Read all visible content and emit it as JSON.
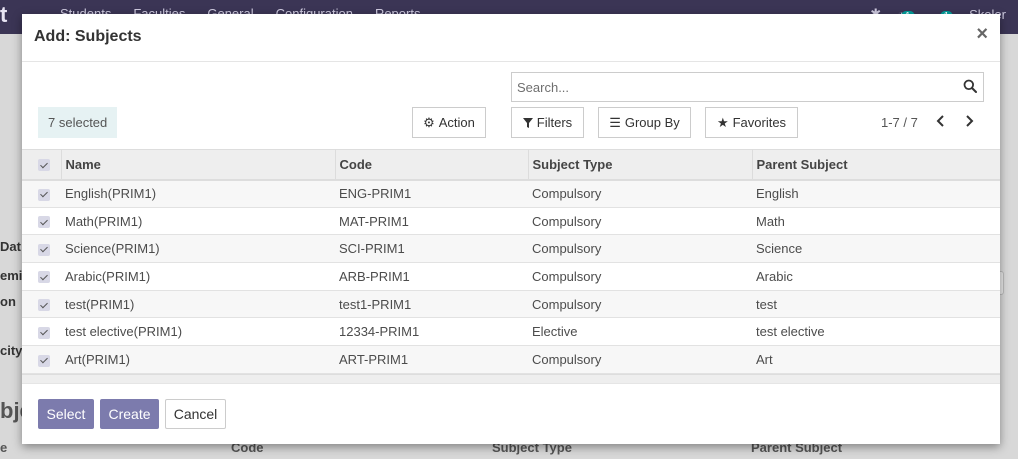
{
  "background": {
    "brand": "t",
    "menu": [
      "Students",
      "Faculties",
      "General",
      "Configuration",
      "Reports"
    ],
    "user": "Skoler",
    "chat_badge": "1",
    "activity_badge": "1",
    "field_labels": [
      "Dat",
      "emic",
      "on",
      "city"
    ],
    "subtitle": "bje",
    "table_headers": {
      "first": "e",
      "code": "Code",
      "subject_type": "Subject Type",
      "parent": "Parent Subject"
    }
  },
  "modal": {
    "title": "Add: Subjects",
    "close": "×"
  },
  "search": {
    "placeholder": "Search..."
  },
  "selection": {
    "label": "7 selected"
  },
  "toolbar": {
    "action": "Action",
    "filters": "Filters",
    "group_by": "Group By",
    "favorites": "Favorites"
  },
  "pager": {
    "value": "1-7 / 7"
  },
  "table": {
    "headers": {
      "name": "Name",
      "code": "Code",
      "subject_type": "Subject Type",
      "parent": "Parent Subject"
    },
    "rows": [
      {
        "name": "English(PRIM1)",
        "code": "ENG-PRIM1",
        "subject_type": "Compulsory",
        "parent": "English"
      },
      {
        "name": "Math(PRIM1)",
        "code": "MAT-PRIM1",
        "subject_type": "Compulsory",
        "parent": "Math"
      },
      {
        "name": "Science(PRIM1)",
        "code": "SCI-PRIM1",
        "subject_type": "Compulsory",
        "parent": "Science"
      },
      {
        "name": "Arabic(PRIM1)",
        "code": "ARB-PRIM1",
        "subject_type": "Compulsory",
        "parent": "Arabic"
      },
      {
        "name": "test(PRIM1)",
        "code": "test1-PRIM1",
        "subject_type": "Compulsory",
        "parent": "test"
      },
      {
        "name": "test elective(PRIM1)",
        "code": "12334-PRIM1",
        "subject_type": "Elective",
        "parent": "test elective"
      },
      {
        "name": "Art(PRIM1)",
        "code": "ART-PRIM1",
        "subject_type": "Compulsory",
        "parent": "Art"
      }
    ]
  },
  "footer": {
    "select": "Select",
    "create": "Create",
    "cancel": "Cancel"
  },
  "colors": {
    "primary": "#7c7bad",
    "navbar": "#3b3555",
    "selected_bg": "#e6f2f3"
  }
}
